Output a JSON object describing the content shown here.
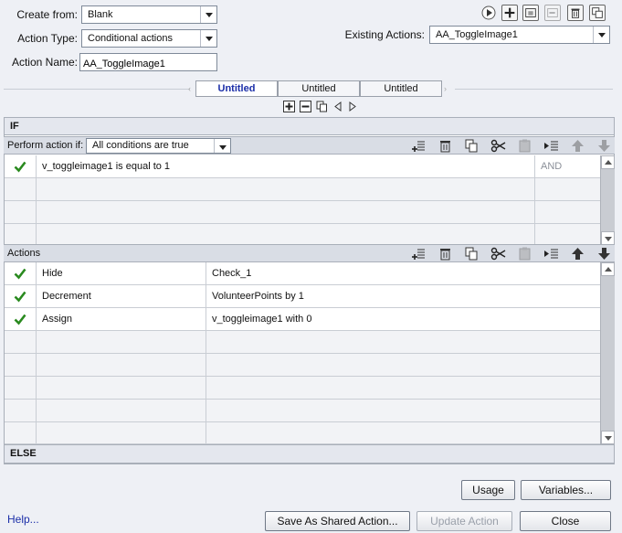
{
  "form": {
    "create_from_label": "Create from:",
    "create_from_value": "Blank",
    "action_type_label": "Action Type:",
    "action_type_value": "Conditional actions",
    "action_name_label": "Action Name:",
    "action_name_value": "AA_ToggleImage1",
    "existing_actions_label": "Existing Actions:",
    "existing_actions_value": "AA_ToggleImage1"
  },
  "tabs": [
    {
      "label": "Untitled",
      "active": true
    },
    {
      "label": "Untitled",
      "active": false
    },
    {
      "label": "Untitled",
      "active": false
    }
  ],
  "if_section": {
    "header": "IF",
    "perform_label": "Perform action if:",
    "perform_value": "All conditions are true",
    "conditions": [
      {
        "text": "v_toggleimage1   is equal to   1",
        "operator": "AND"
      }
    ]
  },
  "actions_section": {
    "header": "Actions",
    "rows": [
      {
        "action": "Hide",
        "target": "Check_1"
      },
      {
        "action": "Decrement",
        "target": "VolunteerPoints   by   1"
      },
      {
        "action": "Assign",
        "target": "v_toggleimage1   with   0"
      }
    ]
  },
  "else_section": {
    "header": "ELSE"
  },
  "buttons": {
    "usage": "Usage",
    "variables": "Variables...",
    "save_shared": "Save As Shared Action...",
    "update_action": "Update Action",
    "close": "Close",
    "help": "Help..."
  },
  "colors": {
    "check": "#2a8a1f",
    "link": "#1b2ea8",
    "active_tab_text": "#1b2ea8"
  }
}
